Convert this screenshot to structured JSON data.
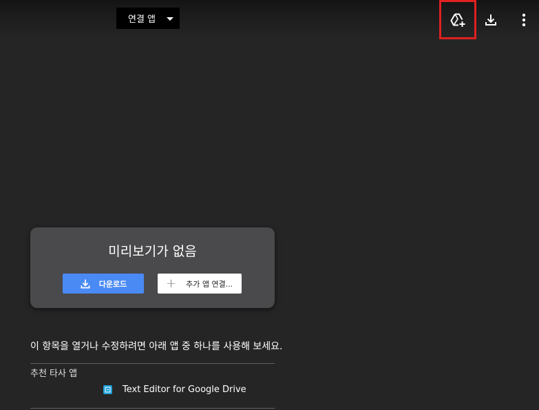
{
  "toolbar": {
    "open_with_label": "연결 앱",
    "icons": [
      "add-to-drive-icon",
      "download-icon",
      "more-vert-icon"
    ]
  },
  "preview": {
    "title": "미리보기가 없음",
    "download_label": "다운로드",
    "connect_label": "추가 앱 연결..."
  },
  "instructions": "이 항목을 열거나 수정하려면 아래 앱 중 하나를 사용해 보세요.",
  "suggested": {
    "section_label": "추천 타사 앱",
    "apps": [
      {
        "name": "Text Editor for Google Drive",
        "icon": "text-editor-app-icon"
      }
    ]
  },
  "colors": {
    "background": "#252525",
    "card": "#4a494b",
    "primary_button": "#4a8af4",
    "highlight": "#e02020"
  }
}
